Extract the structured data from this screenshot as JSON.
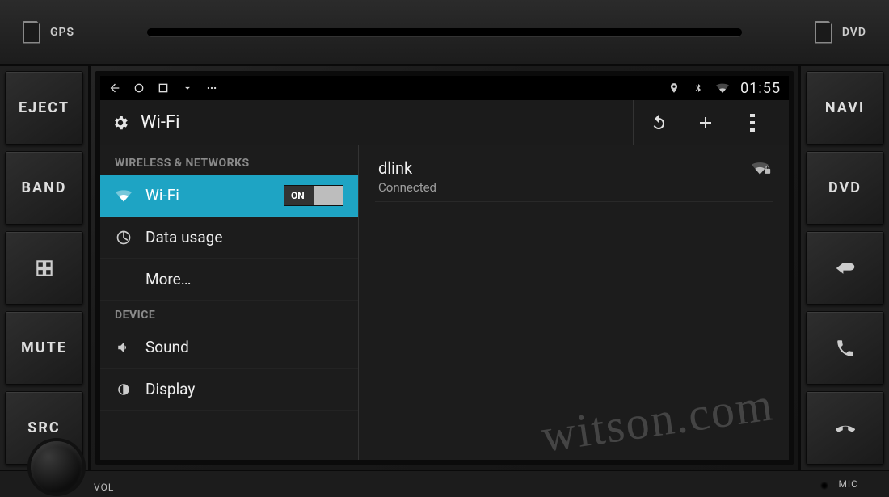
{
  "hardware": {
    "slot_left": "GPS",
    "slot_right": "DVD",
    "left_buttons": [
      "EJECT",
      "BAND",
      "",
      "MUTE",
      "SRC"
    ],
    "right_buttons": [
      "NAVI",
      "DVD",
      "",
      "",
      ""
    ],
    "bottom_left": "VOL",
    "bottom_right": "MIC"
  },
  "statusbar": {
    "time": "01:55"
  },
  "actionbar": {
    "title": "Wi-Fi"
  },
  "settings": {
    "section1": "WIRELESS & NETWORKS",
    "wifi_label": "Wi-Fi",
    "wifi_toggle": "ON",
    "data_usage": "Data usage",
    "more": "More…",
    "section2": "DEVICE",
    "sound": "Sound",
    "display": "Display"
  },
  "network": {
    "ssid": "dlink",
    "status": "Connected"
  },
  "watermark": "witson.com"
}
